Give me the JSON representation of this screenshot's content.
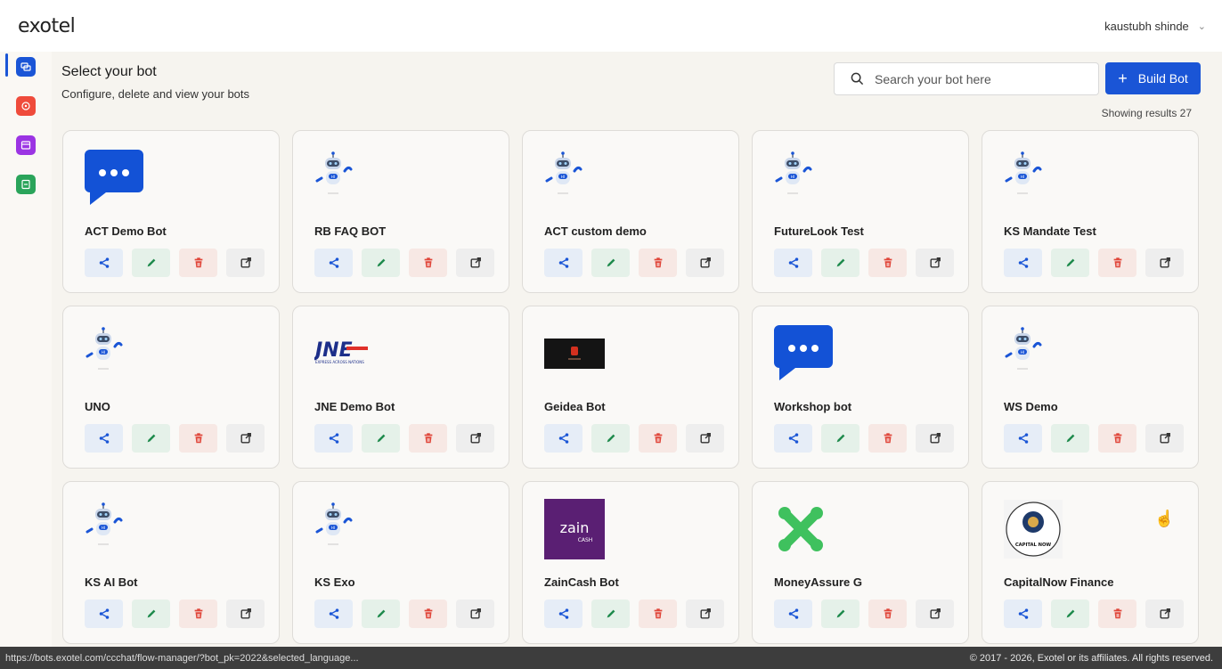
{
  "app": {
    "logo": "exotel",
    "user_name": "kaustubh shinde"
  },
  "header": {
    "title": "Select your bot",
    "subtitle": "Configure, delete and view your bots",
    "search_placeholder": "Search your bot here",
    "build_label": "Build Bot",
    "results_text": "Showing results 27"
  },
  "sidebar": {
    "items": [
      {
        "name": "chat-icon",
        "color": "#1a55d6",
        "active": true
      },
      {
        "name": "bot-icon",
        "color": "#ef4b3b"
      },
      {
        "name": "window-icon",
        "color": "#9b34e3"
      },
      {
        "name": "document-icon",
        "color": "#2aa45a"
      }
    ]
  },
  "bots": [
    {
      "name": "ACT Demo Bot",
      "logo": "chat-bubble"
    },
    {
      "name": "RB FAQ BOT",
      "logo": "robot"
    },
    {
      "name": "ACT custom demo",
      "logo": "robot"
    },
    {
      "name": "FutureLook Test",
      "logo": "robot"
    },
    {
      "name": "KS Mandate Test",
      "logo": "robot"
    },
    {
      "name": "UNO",
      "logo": "robot"
    },
    {
      "name": "JNE Demo Bot",
      "logo": "jne"
    },
    {
      "name": "Geidea Bot",
      "logo": "geidea"
    },
    {
      "name": "Workshop bot",
      "logo": "chat-bubble"
    },
    {
      "name": "WS Demo",
      "logo": "robot"
    },
    {
      "name": "KS AI Bot",
      "logo": "robot"
    },
    {
      "name": "KS Exo",
      "logo": "robot"
    },
    {
      "name": "ZainCash Bot",
      "logo": "zain"
    },
    {
      "name": "MoneyAssure G",
      "logo": "x-mark"
    },
    {
      "name": "CapitalNow Finance",
      "logo": "capital-now"
    }
  ],
  "logo_text": {
    "jne": "JNE",
    "jne_tag": "EXPRESS ACROSS NATIONS",
    "zain": "zain",
    "zain_sub": "CASH",
    "capital": "CAPITAL NOW"
  },
  "actions": [
    "share-icon",
    "edit-icon",
    "delete-icon",
    "open-icon"
  ],
  "footer": {
    "status_url": "https://bots.exotel.com/ccchat/flow-manager/?bot_pk=2022&selected_language...",
    "copyright": "© 2017 - 2026, Exotel or its affiliates. All rights reserved."
  },
  "colors": {
    "primary": "#1a55d6",
    "share": "#1a55d6",
    "edit": "#1e8a4c",
    "delete": "#e0463a",
    "open": "#333333"
  }
}
